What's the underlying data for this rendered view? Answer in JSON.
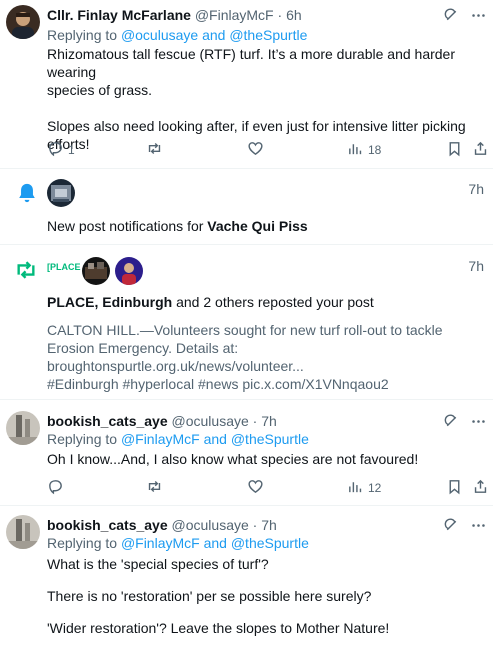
{
  "tweet1": {
    "author_name": "Cllr. Finlay McFarlane",
    "handle": "@FinlayMcF",
    "dot": "·",
    "time": "6h",
    "replying_prefix": "Replying to",
    "replying_targets": "@oculusaye and @theSpurtle",
    "text_line1": "Rhizomatous tall fescue (RTF) turf. It’s a more durable and harder wearing",
    "text_line2": "species of grass.",
    "text_line3": "Slopes also need looking after, if even just for intensive litter picking",
    "text_line4": "efforts!",
    "reply_count": "1",
    "views_count": "18"
  },
  "notif1": {
    "time": "7h",
    "text_prefix": "New post notifications for",
    "text_bold": "Vache Qui Piss"
  },
  "notif2": {
    "time": "7h",
    "place_logo_text": "[PLACE",
    "text_bold": "PLACE, Edinburgh",
    "text_rest": "and 2 others reposted your post",
    "post_line1": "CALTON HILL.—Volunteers sought for new turf roll-out to tackle",
    "post_line2": "Erosion Emergency. Details at:",
    "post_line3": "broughtonspurtle.org.uk/news/volunteer...",
    "post_line4": "#Edinburgh #hyperlocal #news pic.x.com/X1VNnqaou2"
  },
  "tweet2": {
    "author_name": "bookish_cats_aye",
    "handle": "@oculusaye",
    "dot": "·",
    "time": "7h",
    "replying_prefix": "Replying to",
    "replying_targets": "@FinlayMcF and @theSpurtle",
    "text_line1": "Oh I know...And, I also know what species are not favoured!",
    "views_count": "12"
  },
  "tweet3": {
    "author_name": "bookish_cats_aye",
    "handle": "@oculusaye",
    "dot": "·",
    "time": "7h",
    "replying_prefix": "Replying to",
    "replying_targets": "@FinlayMcF and @theSpurtle",
    "text_line1": "What is the 'special species of turf'?",
    "text_line2": "There is no 'restoration' per se possible here surely?",
    "text_line3": "'Wider restoration'? Leave the slopes to Mother Nature!"
  },
  "colors": {
    "accent_blue": "#1d9bf0",
    "repost_green": "#00ba7c",
    "text_gray": "#536471",
    "text_dark": "#0f1419"
  },
  "icons": [
    "grok-icon",
    "more-icon",
    "reply-icon",
    "repost-icon",
    "like-icon",
    "views-icon",
    "bookmark-icon",
    "share-icon",
    "bell-icon"
  ]
}
